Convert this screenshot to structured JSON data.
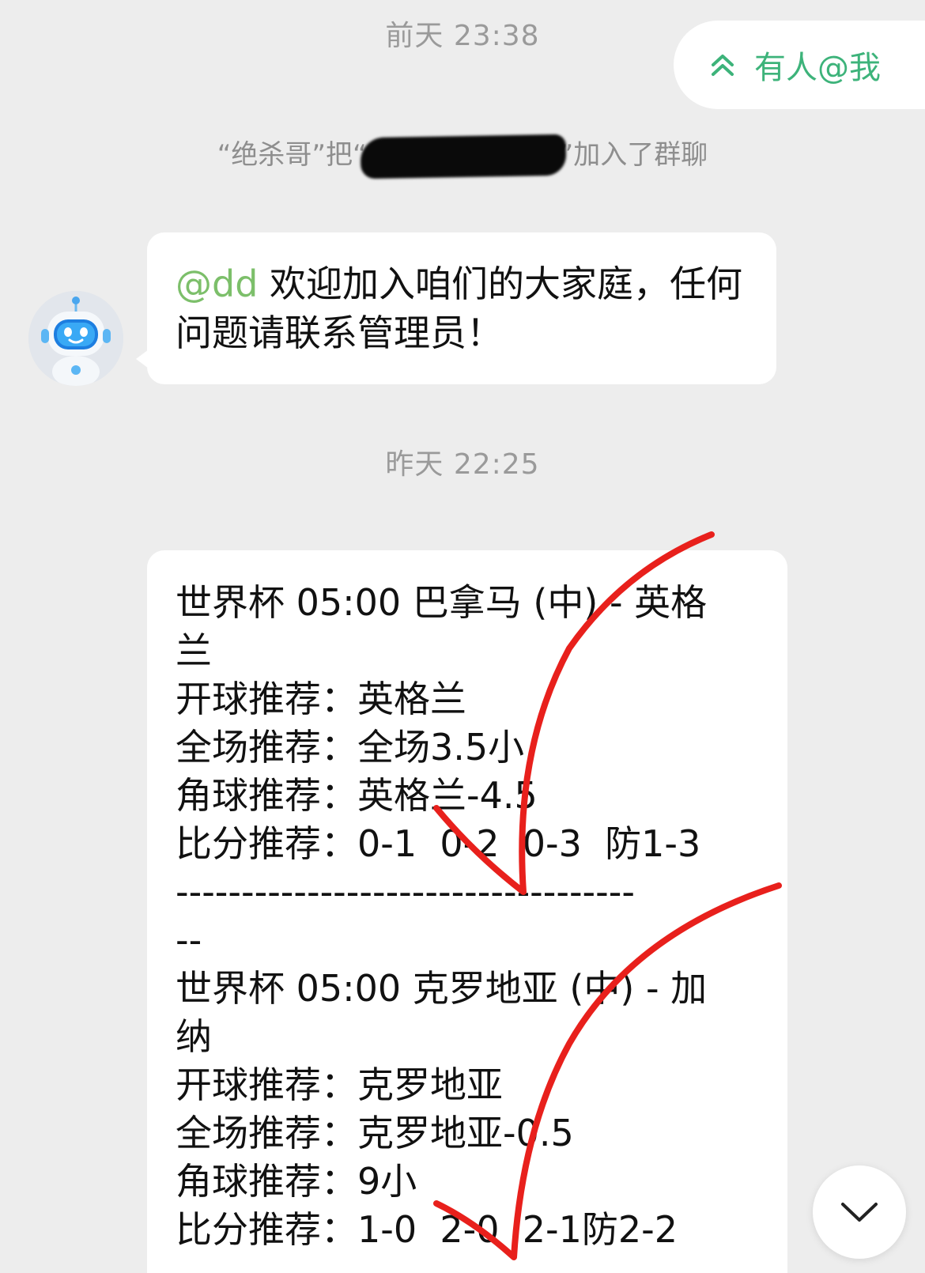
{
  "chat": {
    "timestamp_1": "前天 23:38",
    "mention_pill": {
      "label": "有人@我",
      "icon": "double-chevron-up-icon"
    },
    "system_message": {
      "prefix": "“绝杀哥”把“",
      "suffix": "”加入了群聊"
    },
    "welcome_message": {
      "mention": "@dd",
      "text": " 欢迎加入咱们的大家庭，任何问题请联系管理员！"
    },
    "timestamp_2": "昨天 22:25",
    "recommendation_message": {
      "lines": [
        "世界杯 05:00 巴拿马 (中) - 英格",
        "兰",
        "开球推荐：英格兰",
        "全场推荐：全场3.5小",
        "角球推荐：英格兰-4.5",
        "比分推荐：0-1  0-2  0-3  防1-3",
        "-----------------------------------",
        "--",
        "世界杯 05:00 克罗地亚 (中) - 加",
        "纳",
        "开球推荐：克罗地亚",
        "全场推荐：克罗地亚-0.5",
        "角球推荐：9小",
        "比分推荐：1-0  2-0  2-1防2-2"
      ]
    },
    "scroll_down_icon": "chevron-down-icon",
    "annotation_color": "#e8201c"
  }
}
